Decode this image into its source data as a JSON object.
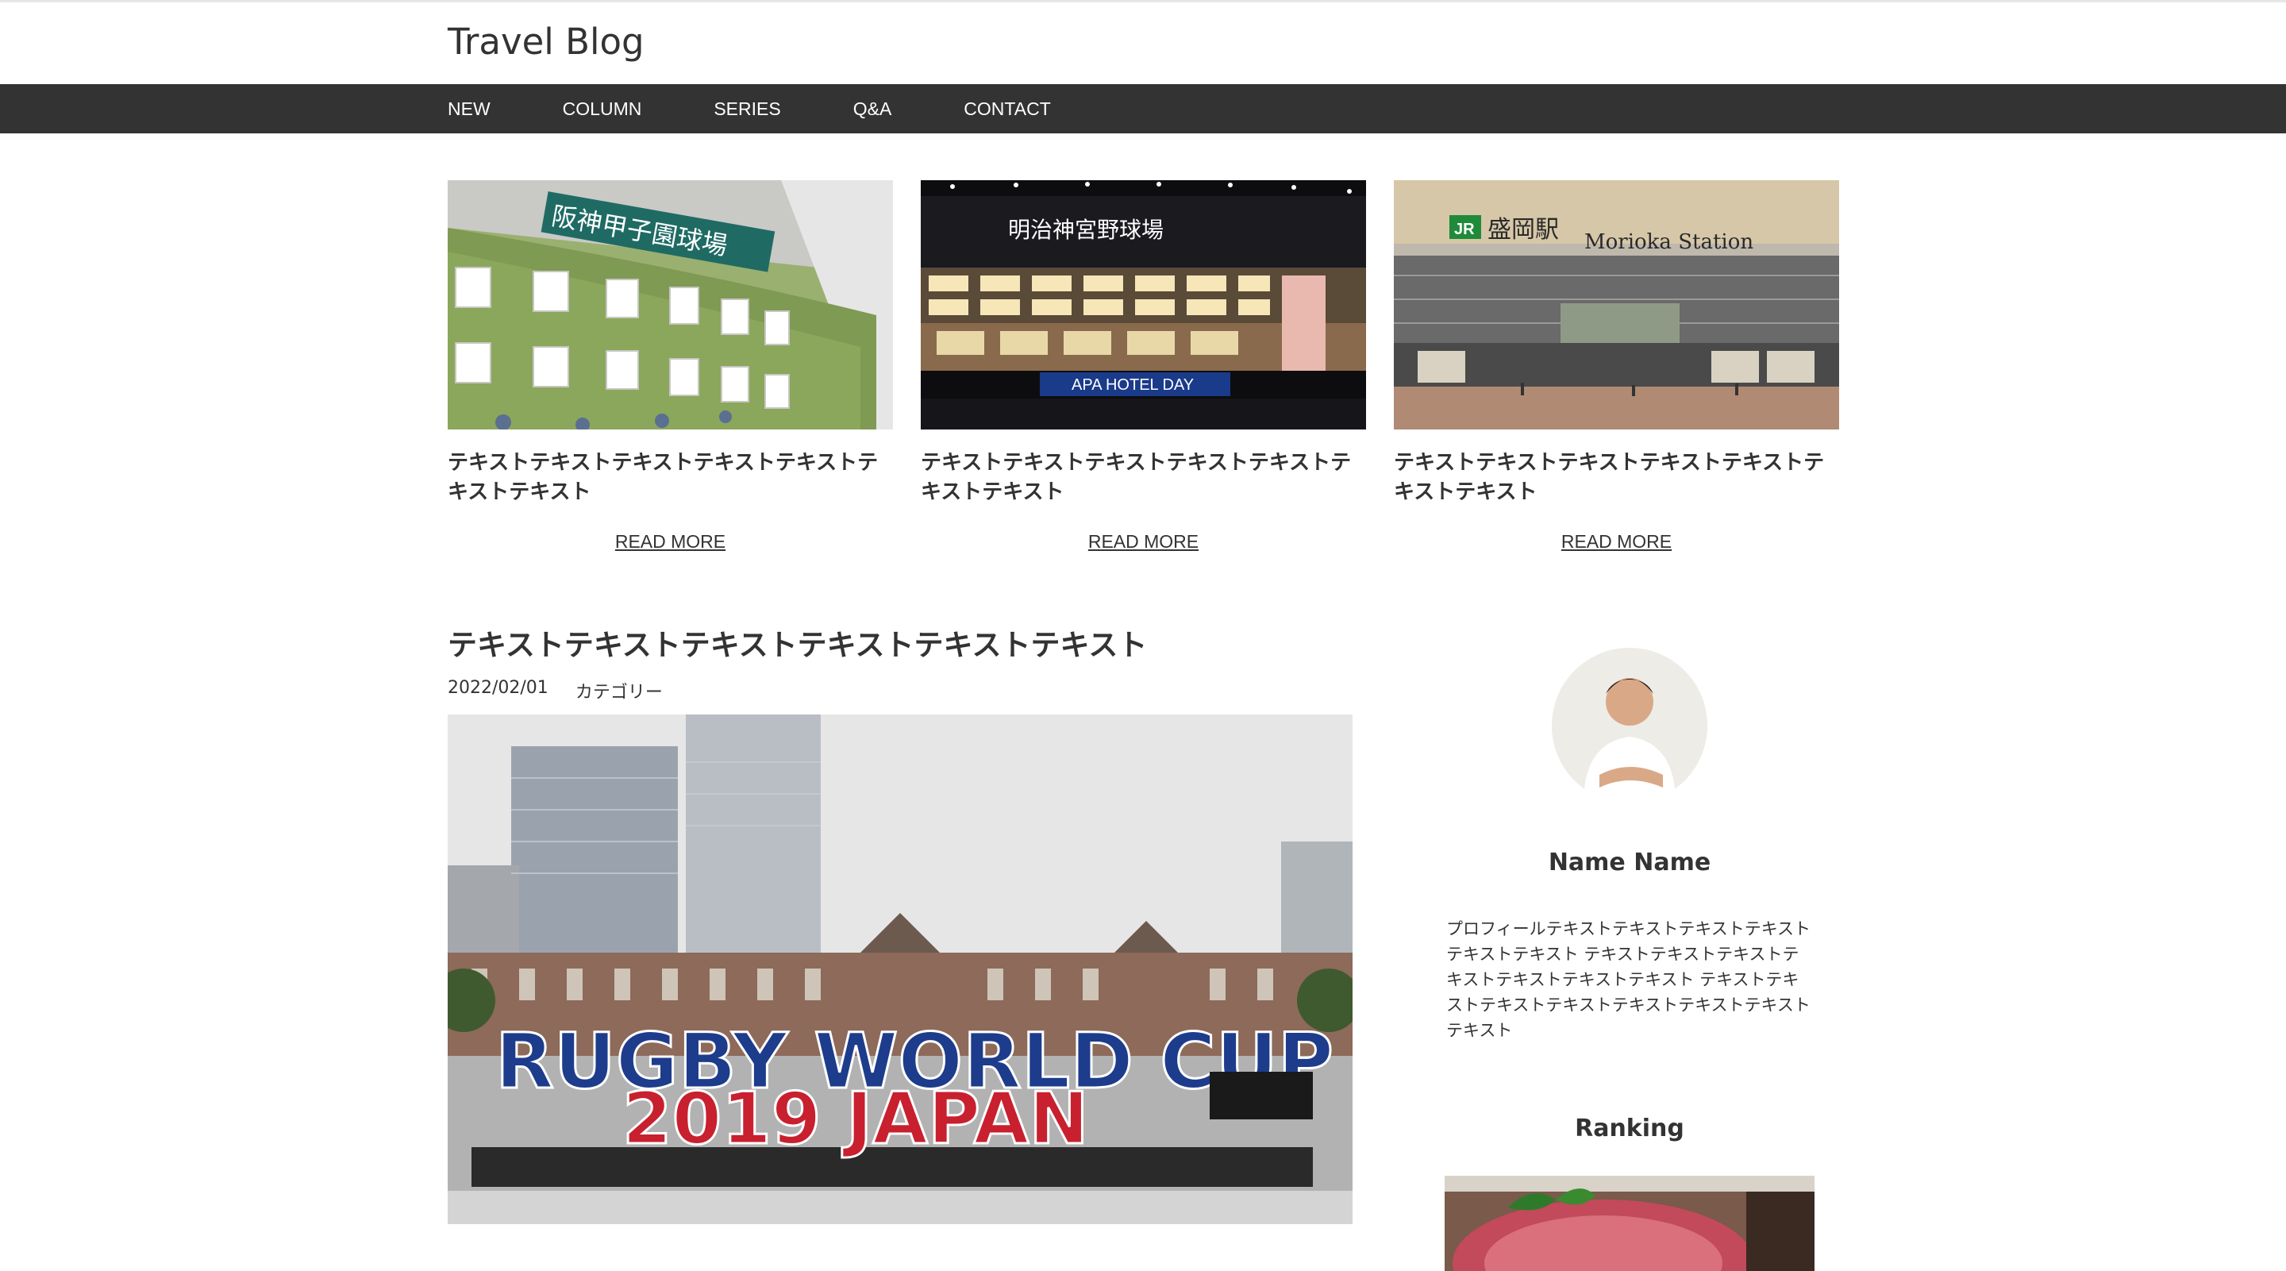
{
  "site": {
    "title": "Travel Blog"
  },
  "nav": {
    "items": [
      {
        "label": "NEW"
      },
      {
        "label": "COLUMN"
      },
      {
        "label": "SERIES"
      },
      {
        "label": "Q&A"
      },
      {
        "label": "CONTACT"
      }
    ]
  },
  "featured": [
    {
      "title": "テキストテキストテキストテキストテキストテキストテキスト",
      "read_more": "READ MORE",
      "image": "koshien-stadium-photo",
      "sign": "阪神甲子園球場"
    },
    {
      "title": "テキストテキストテキストテキストテキストテキストテキスト",
      "read_more": "READ MORE",
      "image": "meiji-jingu-stadium-photo",
      "sign": "明治神宮野球場",
      "banner": "APA HOTEL DAY"
    },
    {
      "title": "テキストテキストテキストテキストテキストテキストテキスト",
      "read_more": "READ MORE",
      "image": "morioka-station-photo",
      "sign": "盛岡駅",
      "sign_en": "Morioka Station",
      "logo": "JR"
    }
  ],
  "post": {
    "title": "テキストテキストテキストテキストテキストテキスト",
    "date": "2022/02/01",
    "category": "カテゴリー",
    "image": "rugby-world-cup-tokyo-station-photo",
    "sign_line1": "RUGBY WORLD CUP",
    "sign_line2": "2019 JAPAN"
  },
  "sidebar": {
    "profile": {
      "name": "Name Name",
      "text": "プロフィールテキストテキストテキストテキストテキストテキスト テキストテキストテキストテキストテキストテキストテキスト テキストテキストテキストテキストテキストテキストテキストテキスト"
    },
    "ranking": {
      "title": "Ranking",
      "image": "wagyu-beef-photo"
    }
  },
  "colors": {
    "nav_bg": "#333333",
    "text": "#333333",
    "background": "#ffffff"
  }
}
